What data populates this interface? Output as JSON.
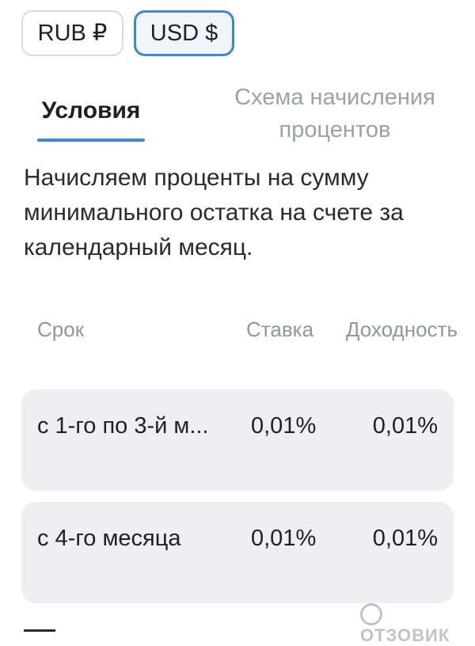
{
  "currency": {
    "options": [
      {
        "label": "RUB ₽",
        "selected": false
      },
      {
        "label": "USD $",
        "selected": true
      }
    ]
  },
  "tabs": [
    {
      "label": "Условия",
      "active": true
    },
    {
      "label": "Схема начисления процентов",
      "active": false
    }
  ],
  "description": "Начисляем проценты на сумму минимального остатка на счете за календарный месяц.",
  "table": {
    "headers": {
      "term": "Срок",
      "rate": "Ставка",
      "yield": "Доходность"
    },
    "rows": [
      {
        "term": "с 1-го по 3-й м...",
        "rate": "0,01%",
        "yield": "0,01%"
      },
      {
        "term": "с 4-го месяца",
        "rate": "0,01%",
        "yield": "0,01%"
      }
    ]
  },
  "watermark": "ОТЗОВИК",
  "colors": {
    "accent": "#3f86d8",
    "muted": "#8e96a1",
    "row_bg": "#eeeff2"
  }
}
